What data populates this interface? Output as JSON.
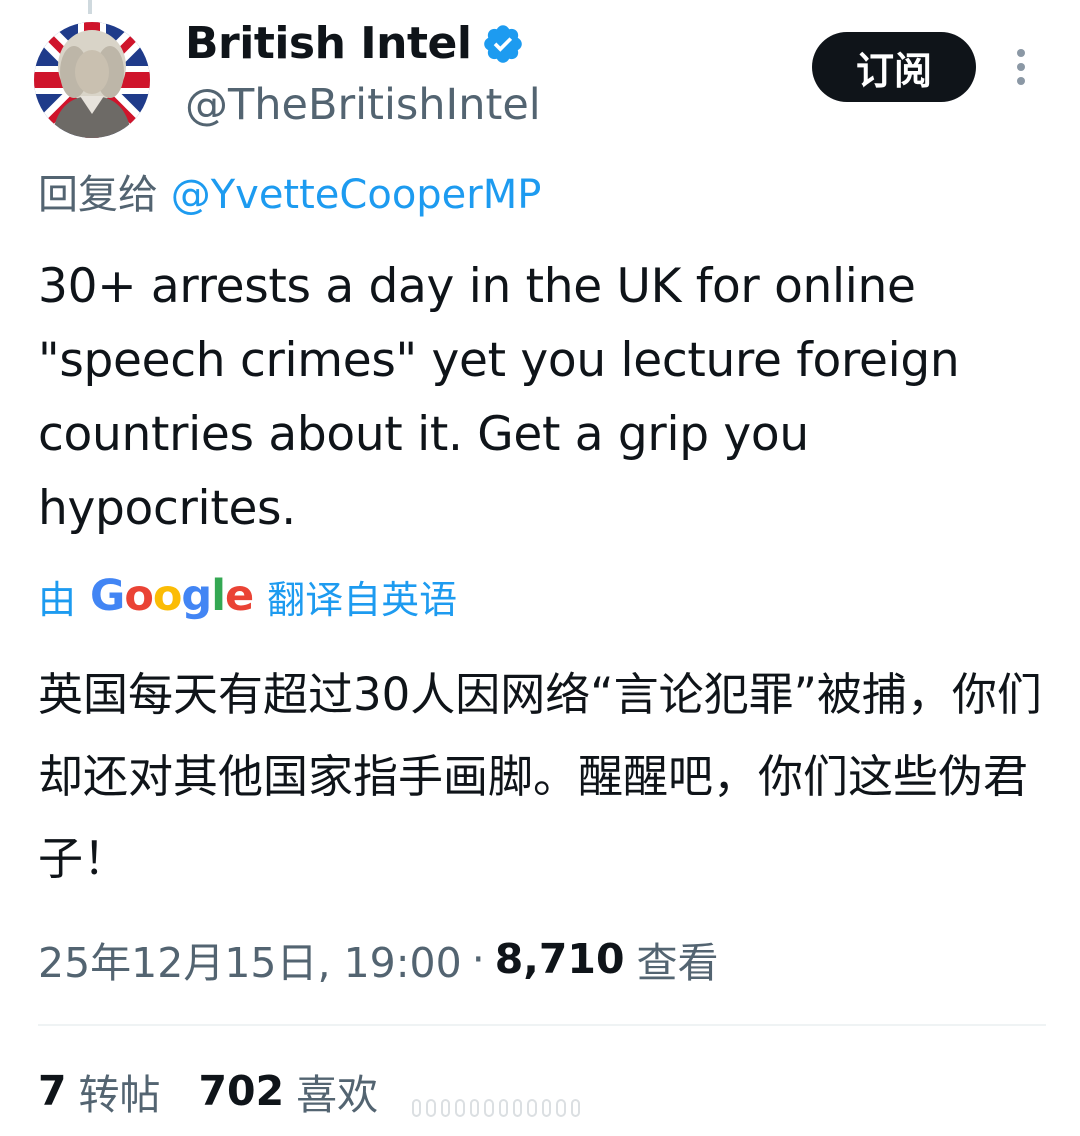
{
  "author": {
    "display_name": "British Intel",
    "handle": "@TheBritishIntel",
    "verified": true,
    "avatar_icon": "profile-avatar"
  },
  "header": {
    "subscribe_label": "订阅",
    "more_icon": "more-vertical-icon"
  },
  "reply": {
    "prefix": "回复给",
    "mention": "@YvetteCooperMP"
  },
  "tweet": {
    "text": "30+ arrests a day in the UK for online \"speech crimes\" yet you lecture foreign countries about it. Get a grip you hypocrites."
  },
  "translation": {
    "prefix": "由",
    "provider": "Google",
    "suffix": "翻译自英语",
    "text": "英国每天有超过30人因网络“言论犯罪”被捕，你们却还对其他国家指手画脚。醒醒吧，你们这些伪君子！"
  },
  "meta": {
    "timestamp": "25年12月15日, 19:00",
    "separator": "·",
    "views_count": "8,710",
    "views_label": "查看"
  },
  "stats": {
    "reposts_count": "7",
    "reposts_label": "转帖",
    "likes_count": "702",
    "likes_label": "喜欢"
  },
  "colors": {
    "text_primary": "#0f1419",
    "text_secondary": "#536471",
    "link_blue": "#1d9bf0",
    "verified_blue": "#1d9bf0",
    "button_bg": "#0f1419"
  }
}
